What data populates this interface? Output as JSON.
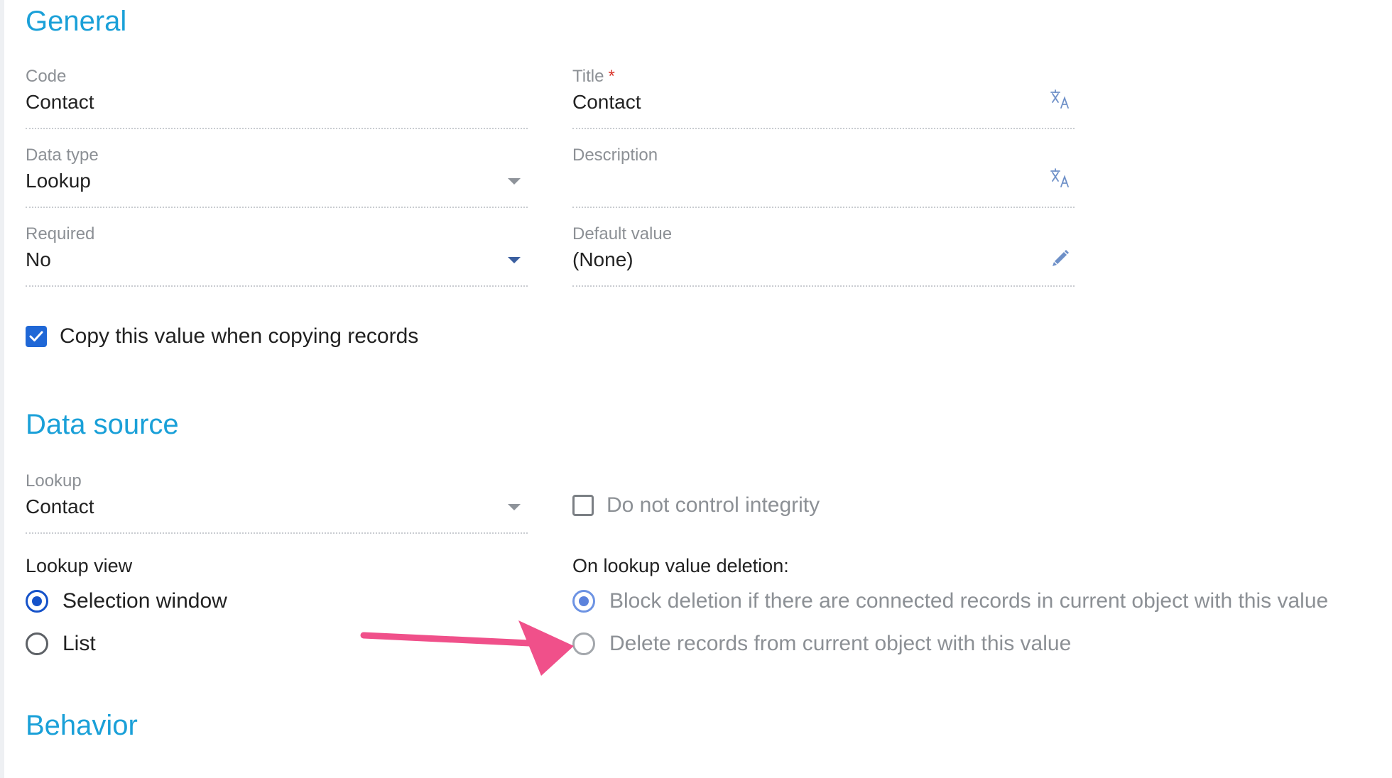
{
  "general": {
    "title": "General",
    "code": {
      "label": "Code",
      "value": "Contact"
    },
    "title_field": {
      "label": "Title",
      "required_mark": "*",
      "value": "Contact",
      "icon": "translate-icon"
    },
    "data_type": {
      "label": "Data type",
      "value": "Lookup"
    },
    "description": {
      "label": "Description",
      "value": "",
      "icon": "translate-icon"
    },
    "required": {
      "label": "Required",
      "value": "No"
    },
    "default_value": {
      "label": "Default value",
      "value": "(None)",
      "icon": "pencil-icon"
    },
    "copy_checkbox": {
      "label": "Copy this value when copying records",
      "checked": true
    }
  },
  "data_source": {
    "title": "Data source",
    "lookup": {
      "label": "Lookup",
      "value": "Contact"
    },
    "integrity_checkbox": {
      "label": "Do not control integrity",
      "checked": false
    },
    "lookup_view": {
      "label": "Lookup view",
      "options": [
        {
          "label": "Selection window",
          "selected": true
        },
        {
          "label": "List",
          "selected": false
        }
      ]
    },
    "on_deletion": {
      "label": "On lookup value deletion:",
      "options": [
        {
          "label": "Block deletion if there are connected records in current object with this value",
          "selected": true
        },
        {
          "label": "Delete records from current object with this value",
          "selected": false
        }
      ]
    }
  },
  "behavior": {
    "title": "Behavior"
  },
  "colors": {
    "section_title": "#1aa0d8",
    "accent": "#1f67d6",
    "annotation_arrow": "#f0508a"
  }
}
